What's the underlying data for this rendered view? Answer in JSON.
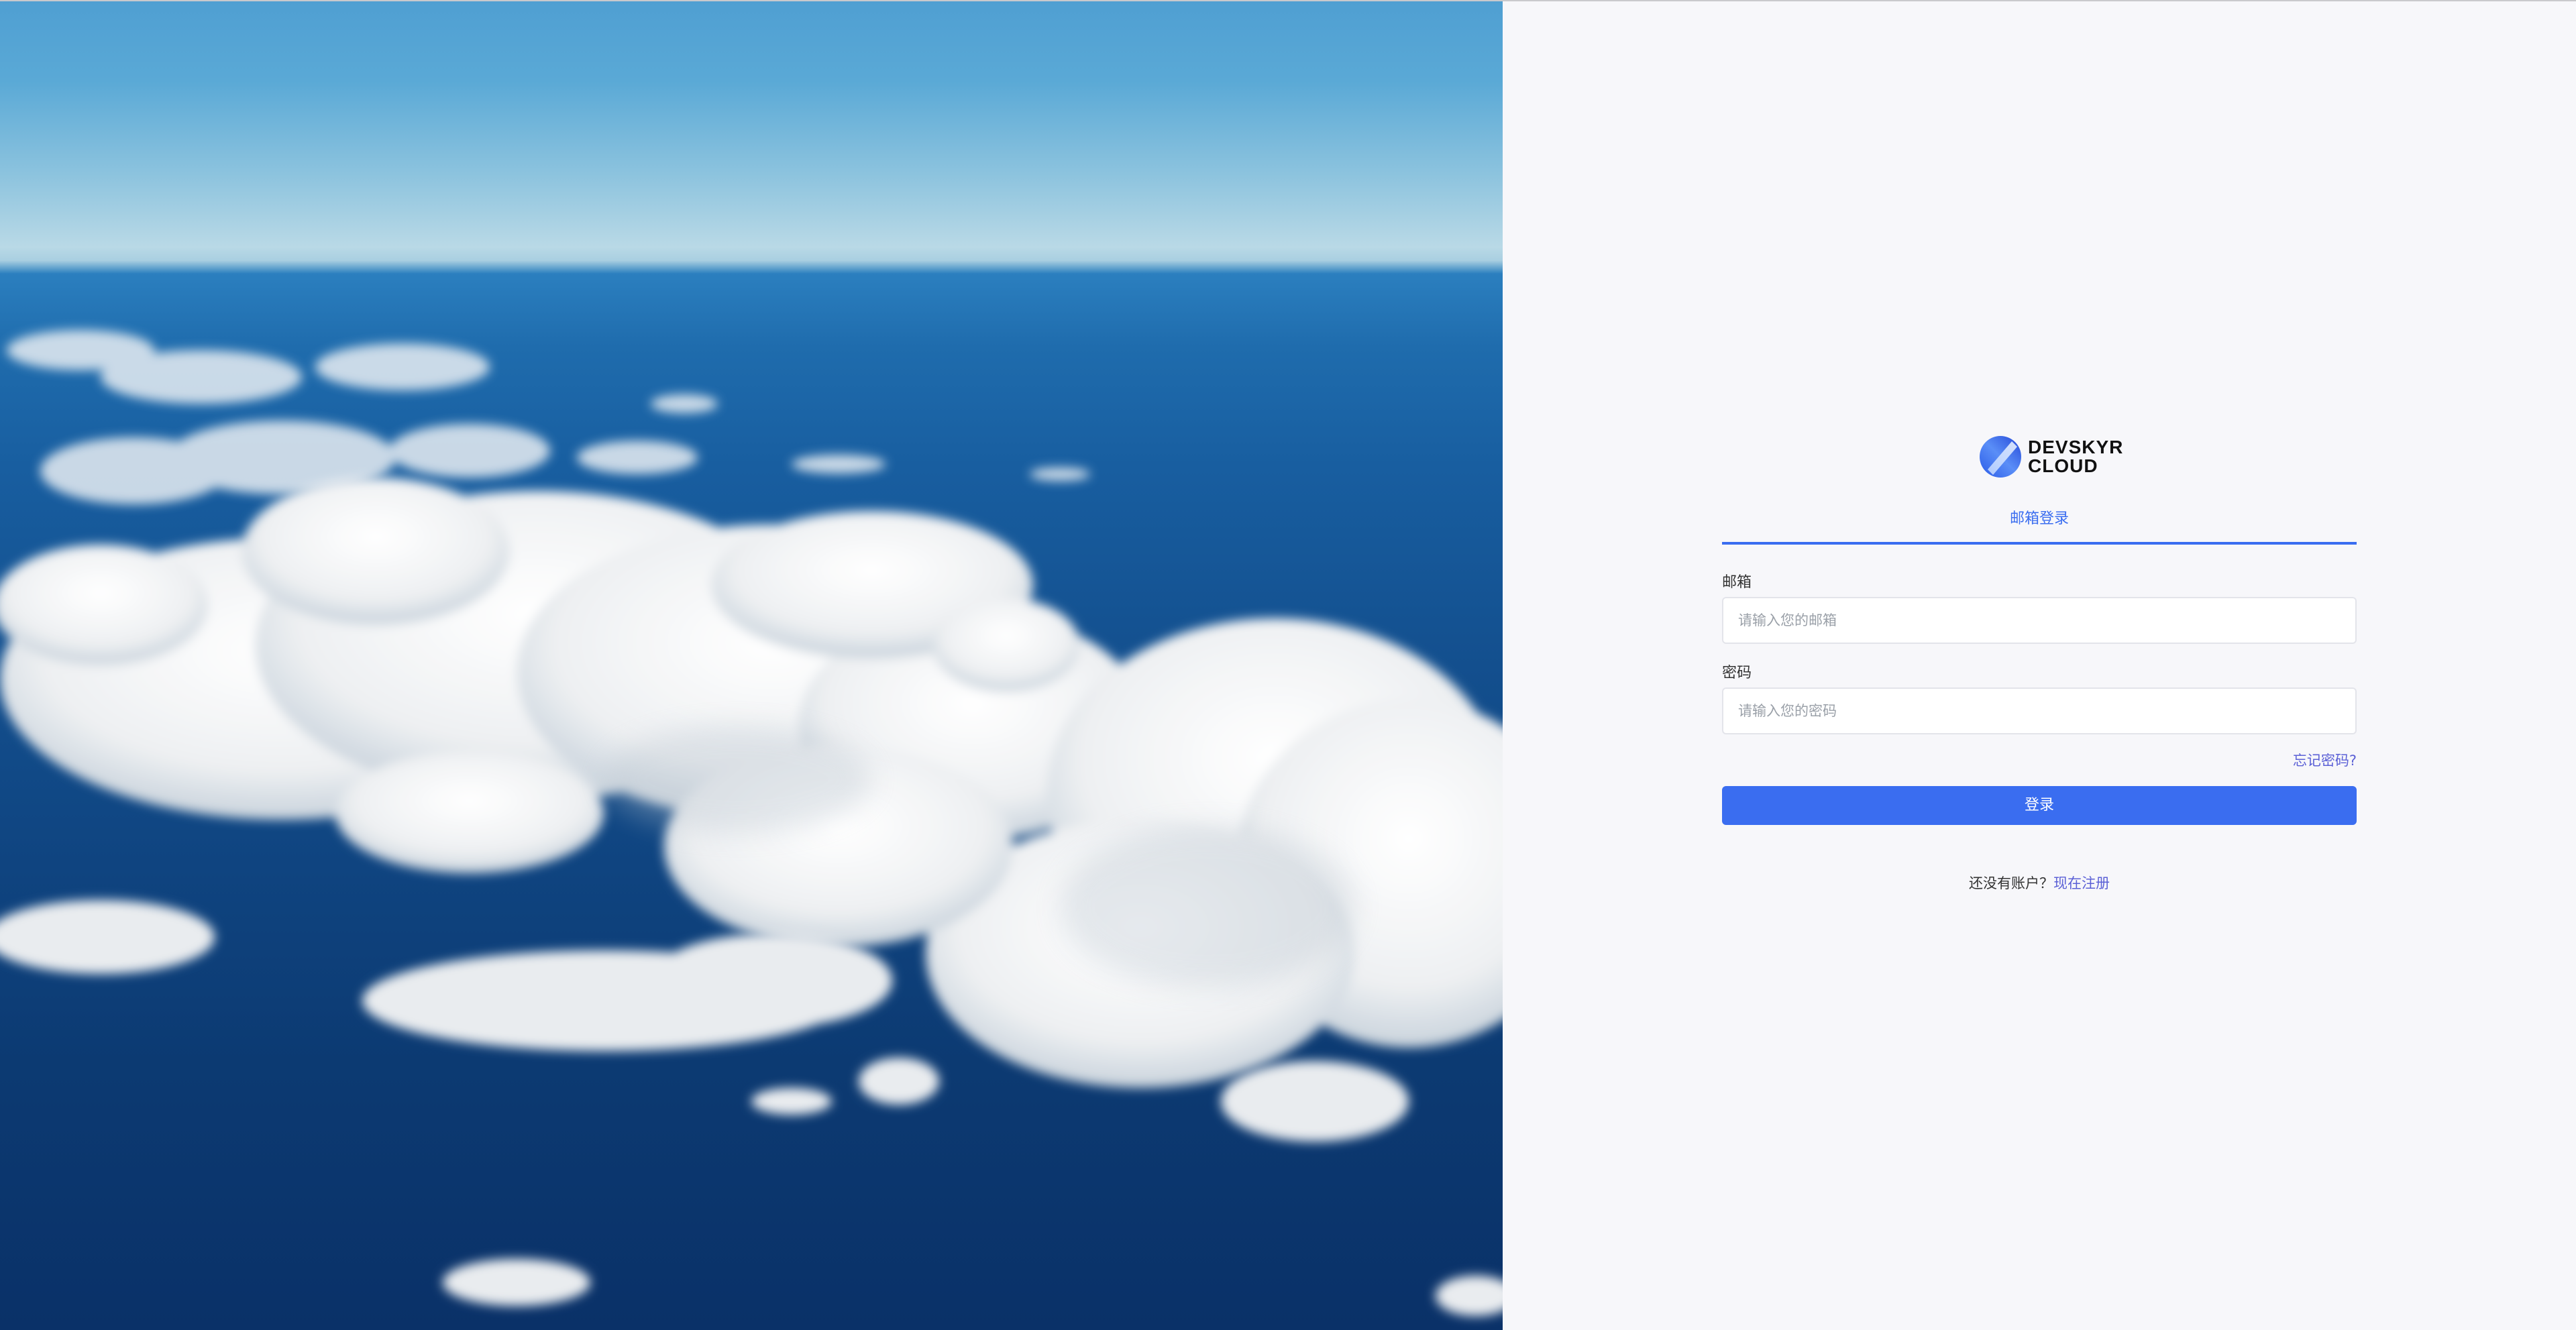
{
  "brand": {
    "name_line1": "DEVSKYR",
    "name_line2": "CLOUD",
    "logo_icon": "devskyr-logo-icon"
  },
  "login": {
    "tab_label": "邮箱登录",
    "email_label": "邮箱",
    "email_placeholder": "请输入您的邮箱",
    "password_label": "密码",
    "password_placeholder": "请输入您的密码",
    "forgot_link": "忘记密码?",
    "submit_label": "登录",
    "no_account_text": "还没有账户？",
    "register_link": "现在注册"
  },
  "colors": {
    "accent": "#3a6df0",
    "link": "#5b60d6",
    "panel_bg": "#f7f7fa"
  }
}
